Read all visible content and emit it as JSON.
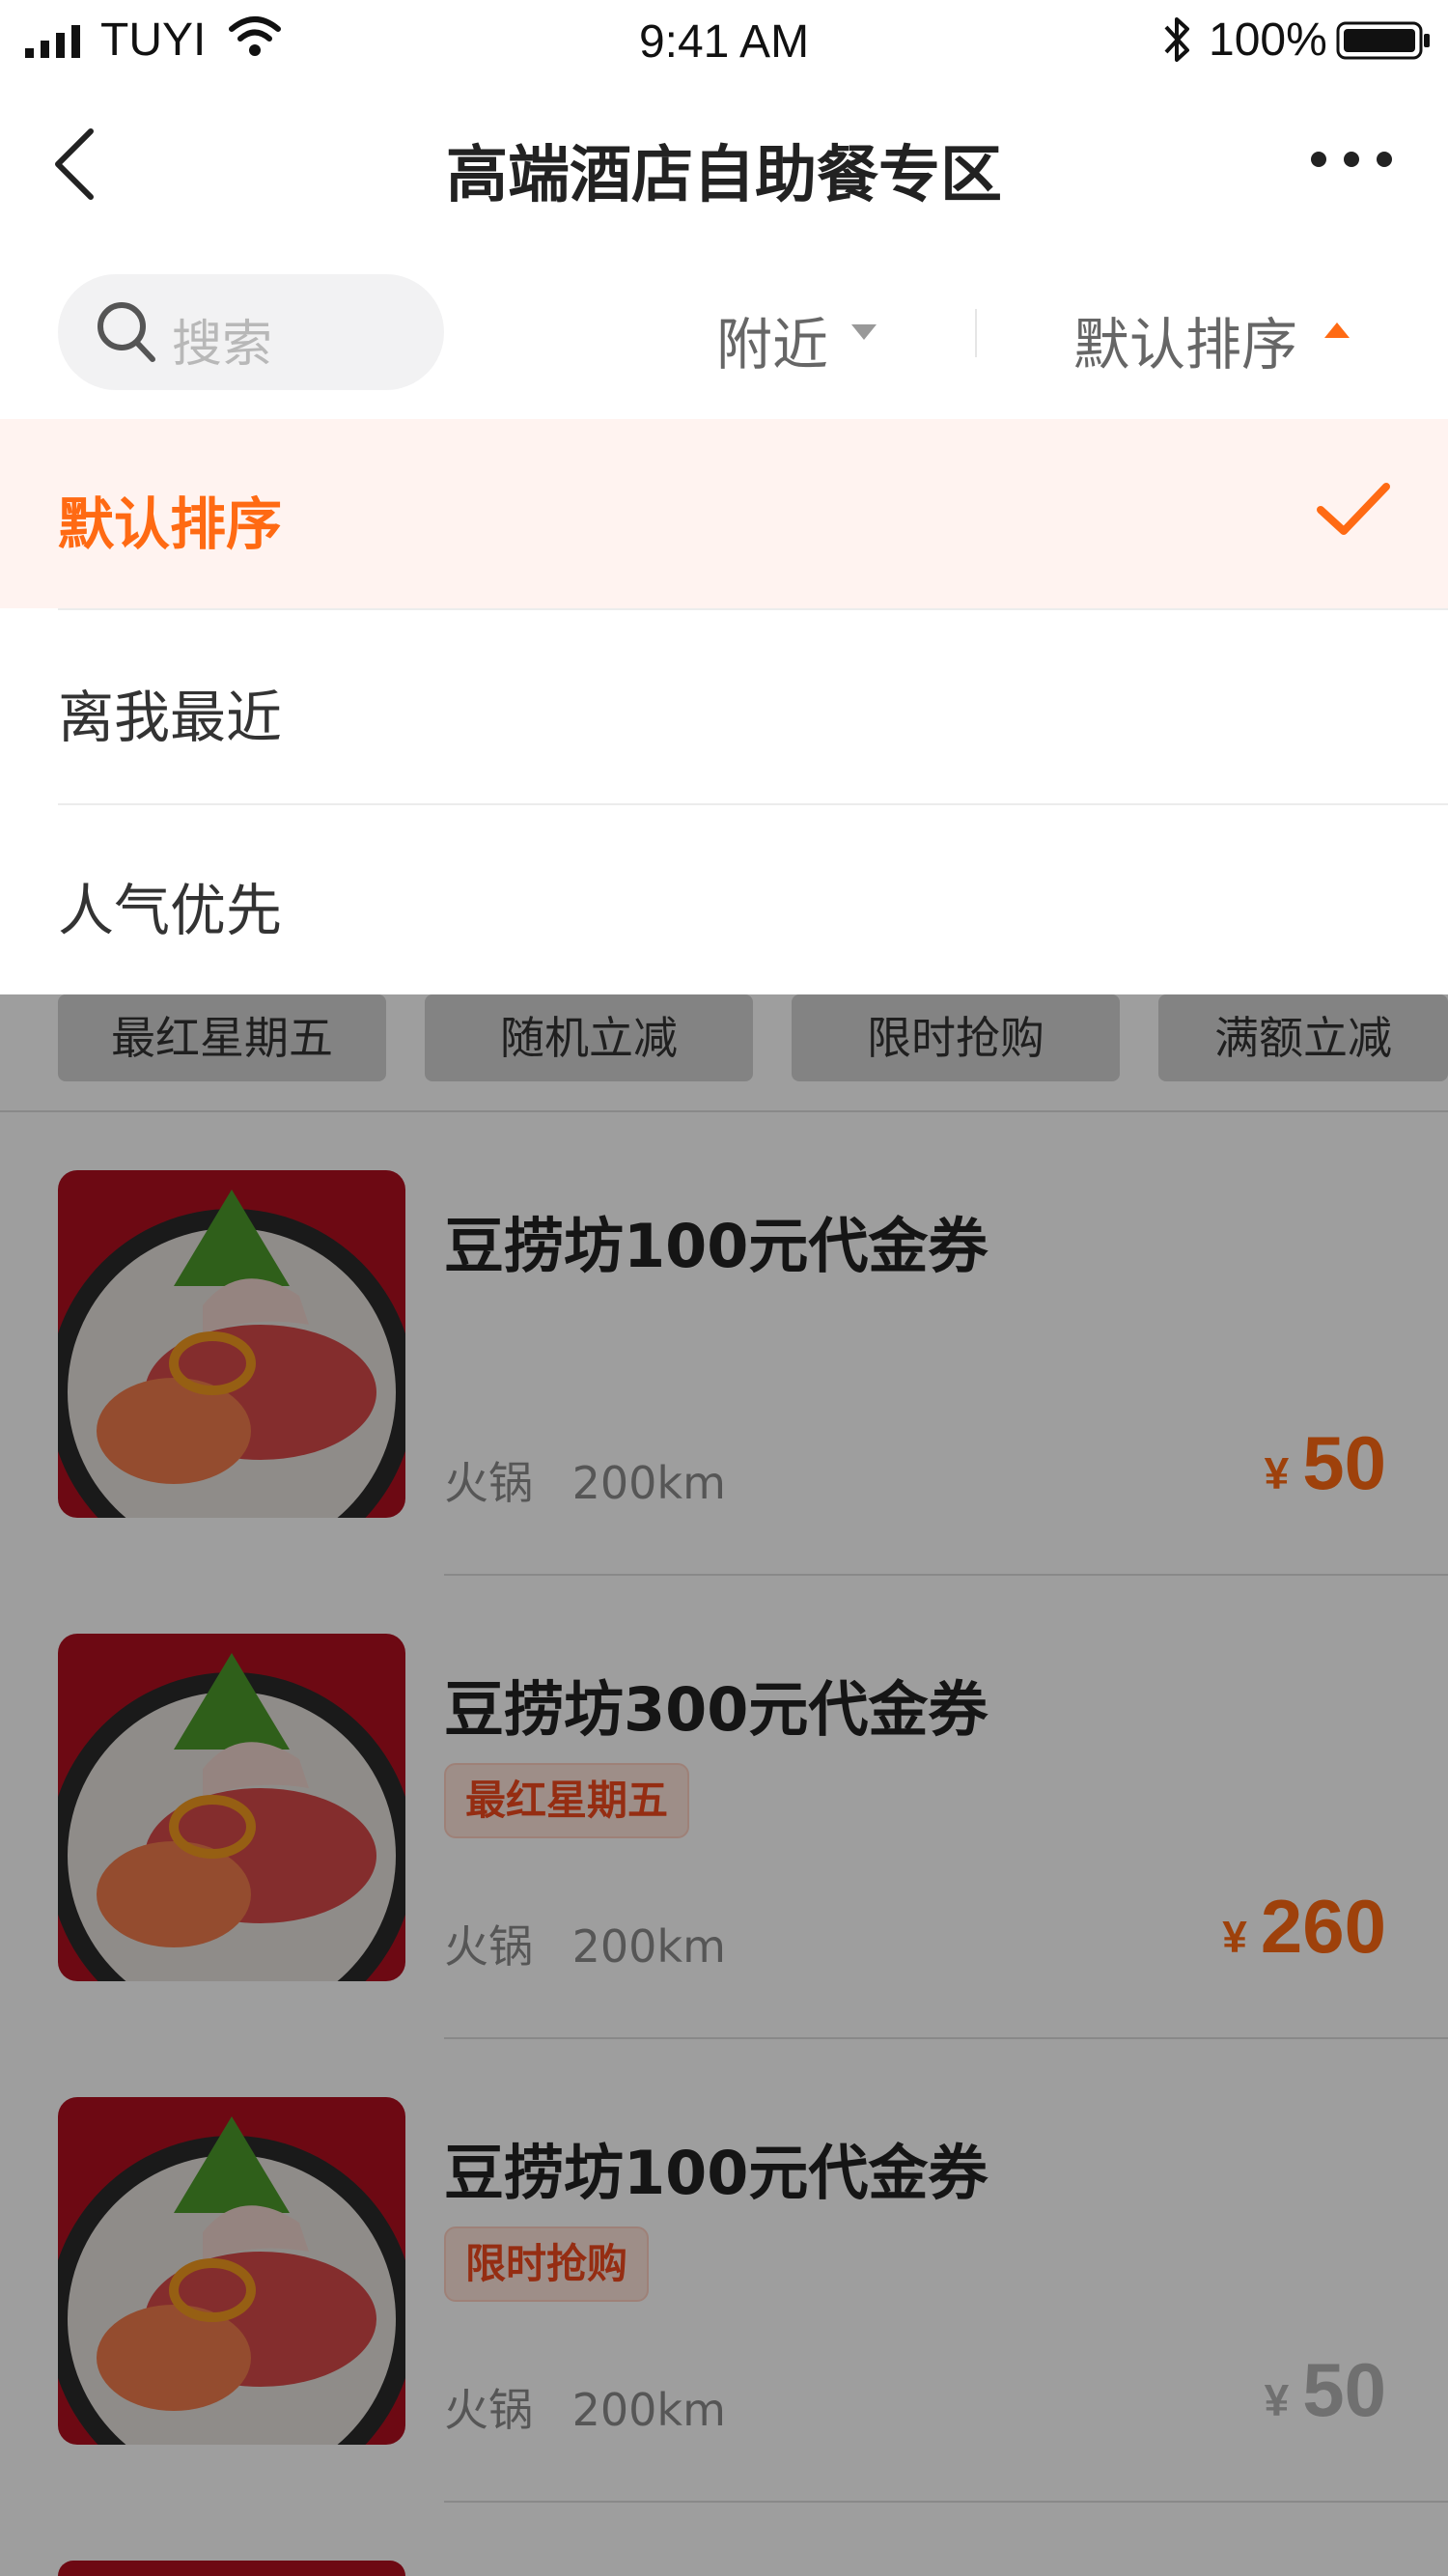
{
  "status_bar": {
    "carrier": "TUYI",
    "time": "9:41 AM",
    "battery": "100%"
  },
  "nav": {
    "title": "高端酒店自助餐专区"
  },
  "filter": {
    "search_placeholder": "搜索",
    "nearby_label": "附近",
    "sort_label": "默认排序"
  },
  "sort_menu": {
    "options": [
      "默认排序",
      "离我最近",
      "人气优先"
    ],
    "selected": "默认排序"
  },
  "tags": [
    "最红星期五",
    "随机立减",
    "限时抢购",
    "满额立减"
  ],
  "items": [
    {
      "title": "豆捞坊100元代金券",
      "tag": "",
      "category": "火锅",
      "distance": "200km",
      "currency": "¥",
      "price": "50"
    },
    {
      "title": "豆捞坊300元代金券",
      "tag": "最红星期五",
      "category": "火锅",
      "distance": "200km",
      "currency": "¥",
      "price": "260"
    },
    {
      "title": "豆捞坊100元代金券",
      "tag": "限时抢购",
      "category": "火锅",
      "distance": "200km",
      "currency": "¥",
      "price": "50"
    }
  ],
  "colors": {
    "accent": "#ff6a13",
    "active_bg": "#fff3f0",
    "tag_red": "#f04a1d"
  },
  "icons": [
    "signal-icon",
    "wifi-icon",
    "bluetooth-icon",
    "battery-icon",
    "back-icon",
    "more-icon",
    "search-icon",
    "caret-down-icon",
    "caret-up-icon",
    "check-icon"
  ]
}
